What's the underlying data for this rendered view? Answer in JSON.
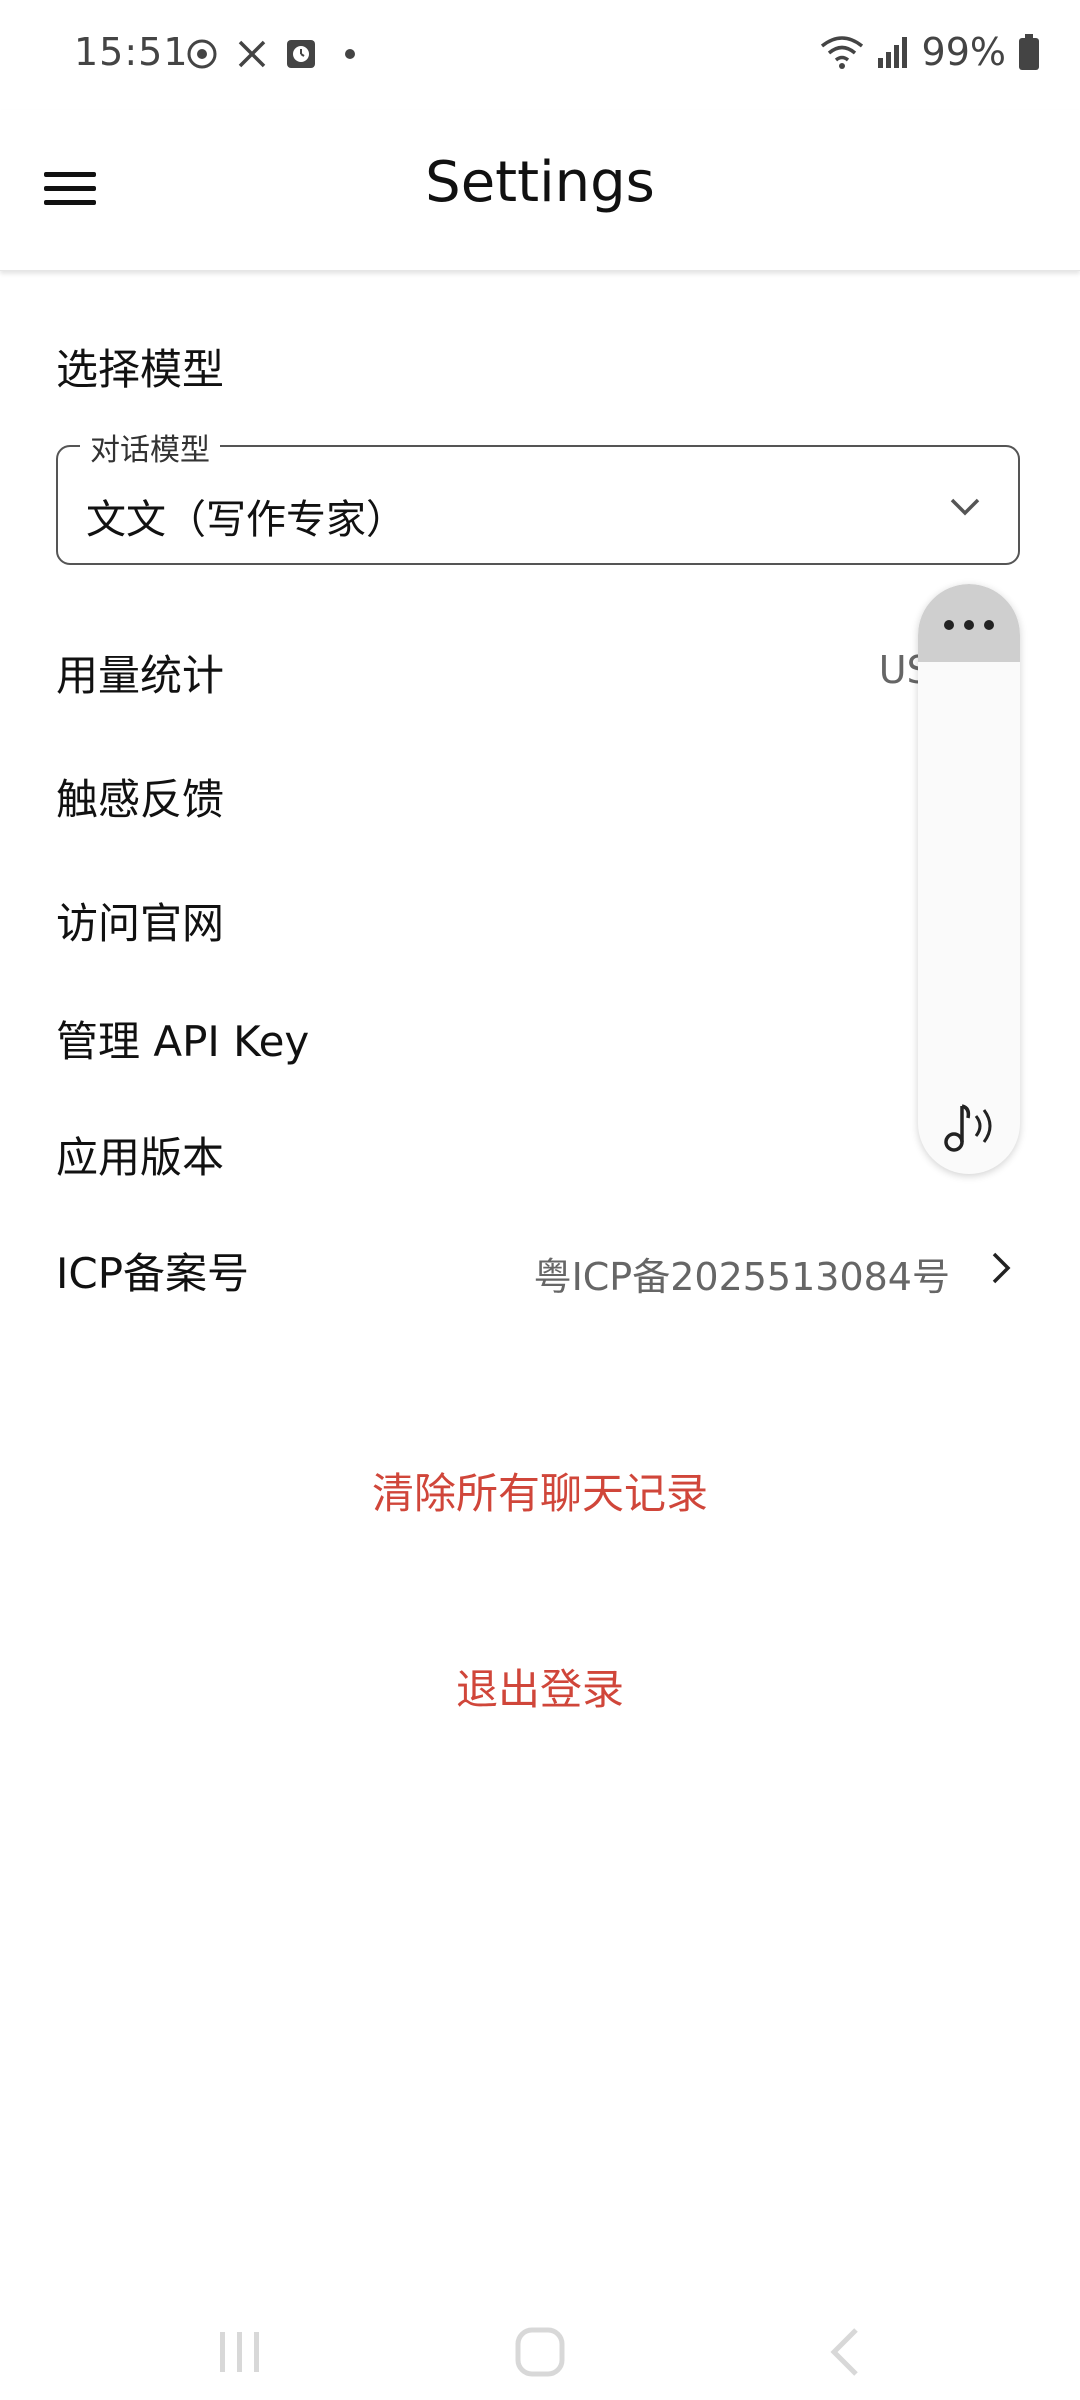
{
  "status_bar": {
    "time": "15:51",
    "battery": "99%",
    "icons": [
      "sync-icon",
      "tools-off-icon",
      "clock-app-icon",
      "dot-icon",
      "wifi-icon",
      "signal-icon",
      "battery-icon"
    ]
  },
  "app_bar": {
    "title": "Settings",
    "menu_icon": "menu-icon"
  },
  "model_section": {
    "title": "选择模型",
    "field_label": "对话模型",
    "selected_value": "文文（写作专家）"
  },
  "rows": {
    "usage": {
      "label": "用量统计",
      "value": "USD"
    },
    "haptic": {
      "label": "触感反馈"
    },
    "website": {
      "label": "访问官网"
    },
    "api_key": {
      "label": "管理 API Key"
    },
    "version": {
      "label": "应用版本"
    },
    "icp": {
      "label": "ICP备案号",
      "value": "粤ICP备2025513084号"
    }
  },
  "actions": {
    "clear_history": "清除所有聊天记录",
    "logout": "退出登录"
  },
  "colors": {
    "danger": "#d0463a",
    "outline": "#555555",
    "secondary_text": "#666666"
  }
}
